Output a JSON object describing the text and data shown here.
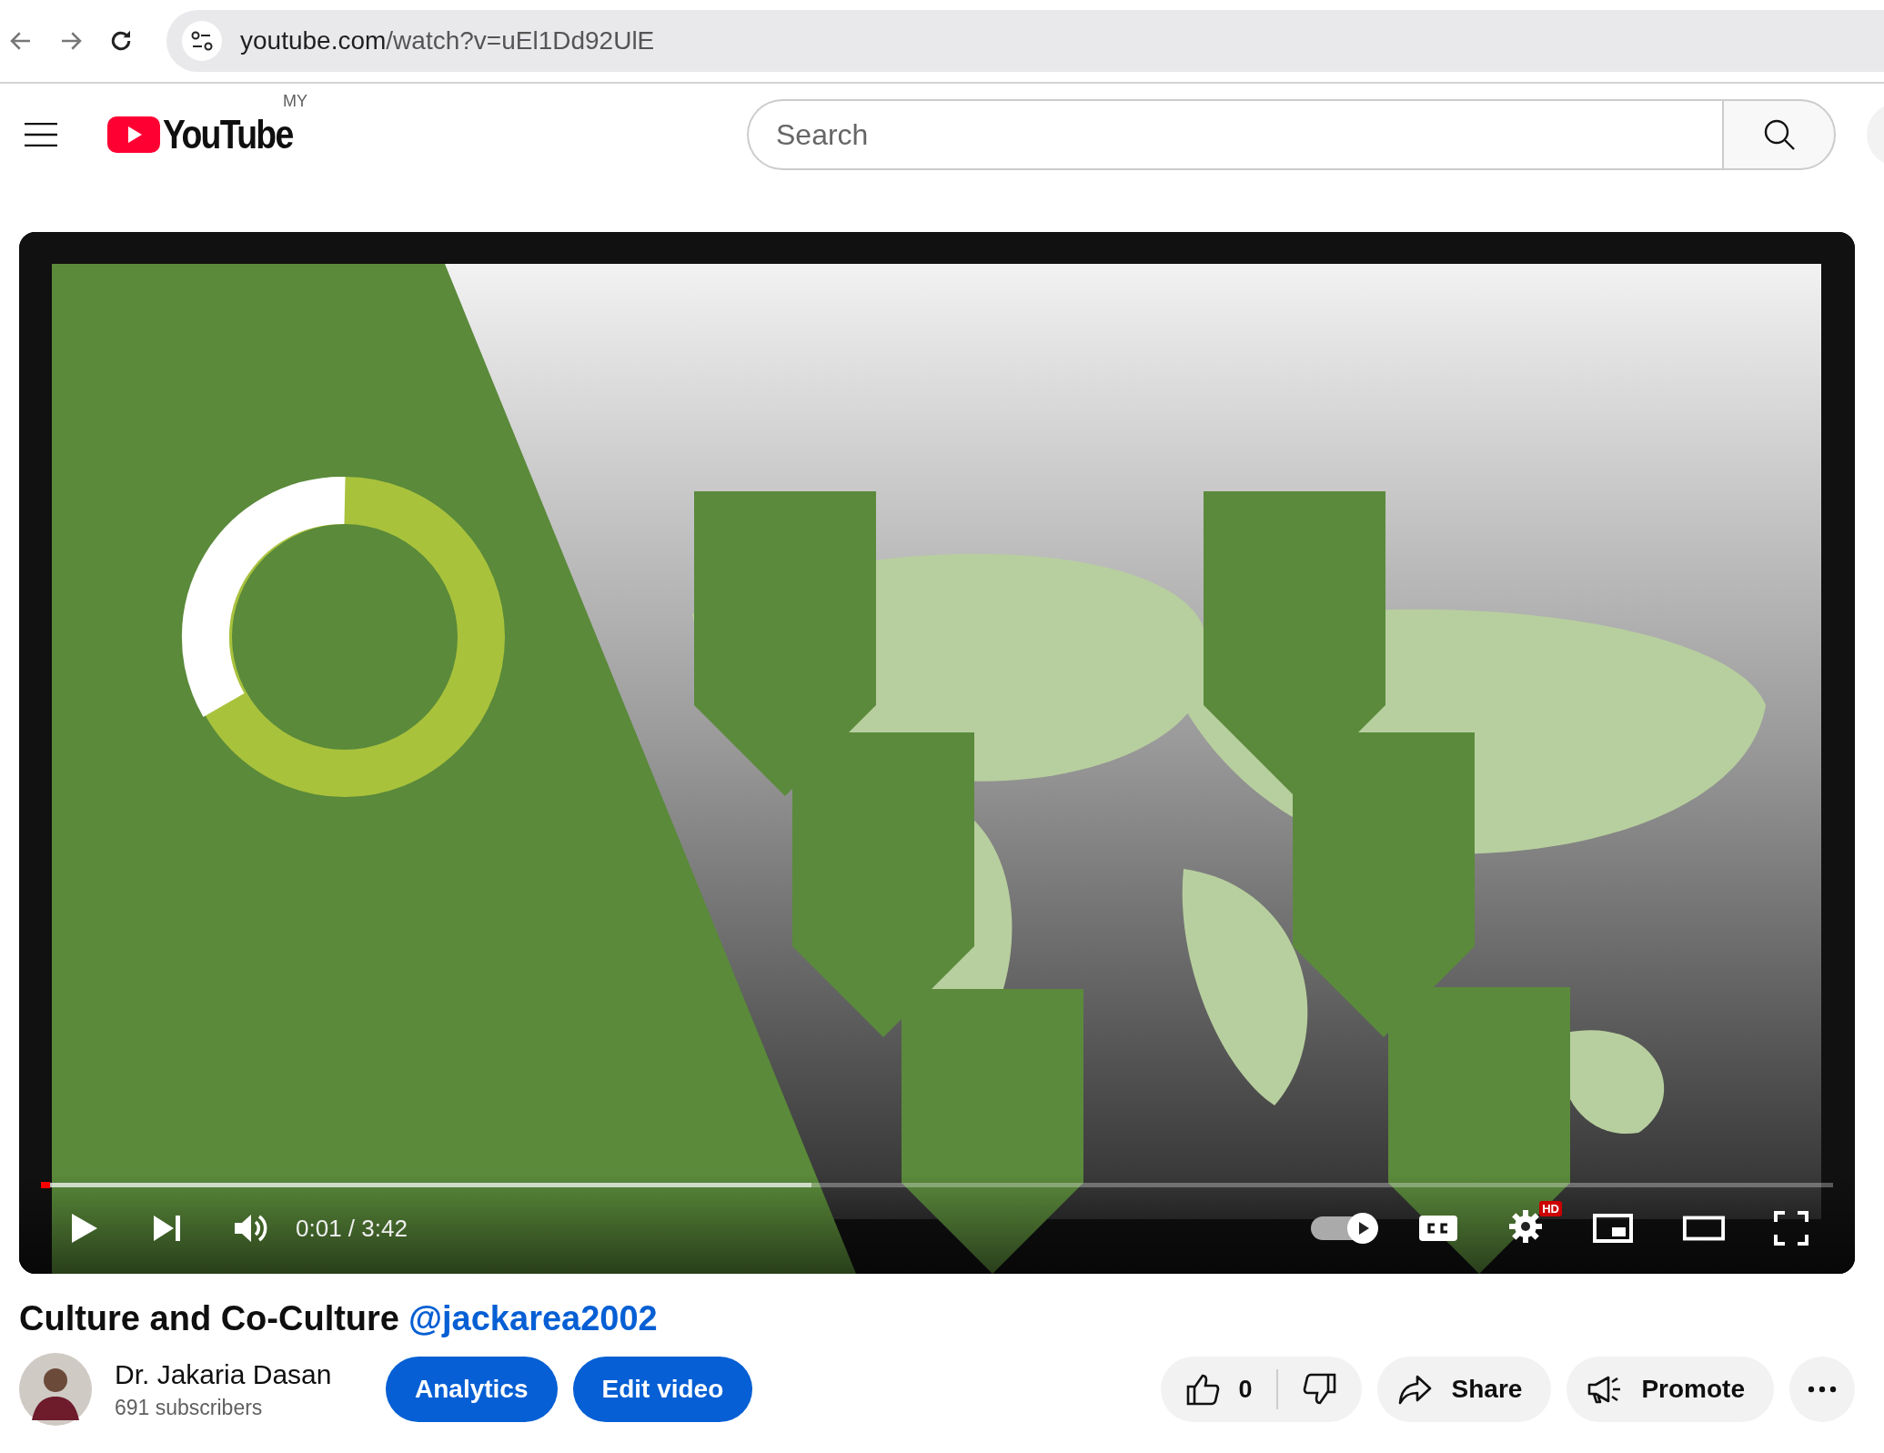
{
  "browser": {
    "url_host": "youtube.com",
    "url_path": "/watch?v=uEl1Dd92UlE"
  },
  "header": {
    "logo_text": "YouTube",
    "region": "MY",
    "search": {
      "placeholder": "Search"
    }
  },
  "player": {
    "progress": {
      "level": 0.005
    },
    "buffer": {
      "level": 0.43
    },
    "time": "0:01 / 3:42",
    "autoplay": true,
    "hd_badge": "HD"
  },
  "video": {
    "title": "Culture and Co-Culture",
    "handle": "@jackarea2002",
    "channel": "Dr. Jakaria Dasan",
    "subscribers": "691 subscribers",
    "buttons": [
      "Analytics",
      "Edit video"
    ],
    "likes": "0",
    "actions": [
      {
        "label": "Share",
        "kind": "share"
      },
      {
        "label": "Promote",
        "kind": "promote"
      }
    ]
  }
}
